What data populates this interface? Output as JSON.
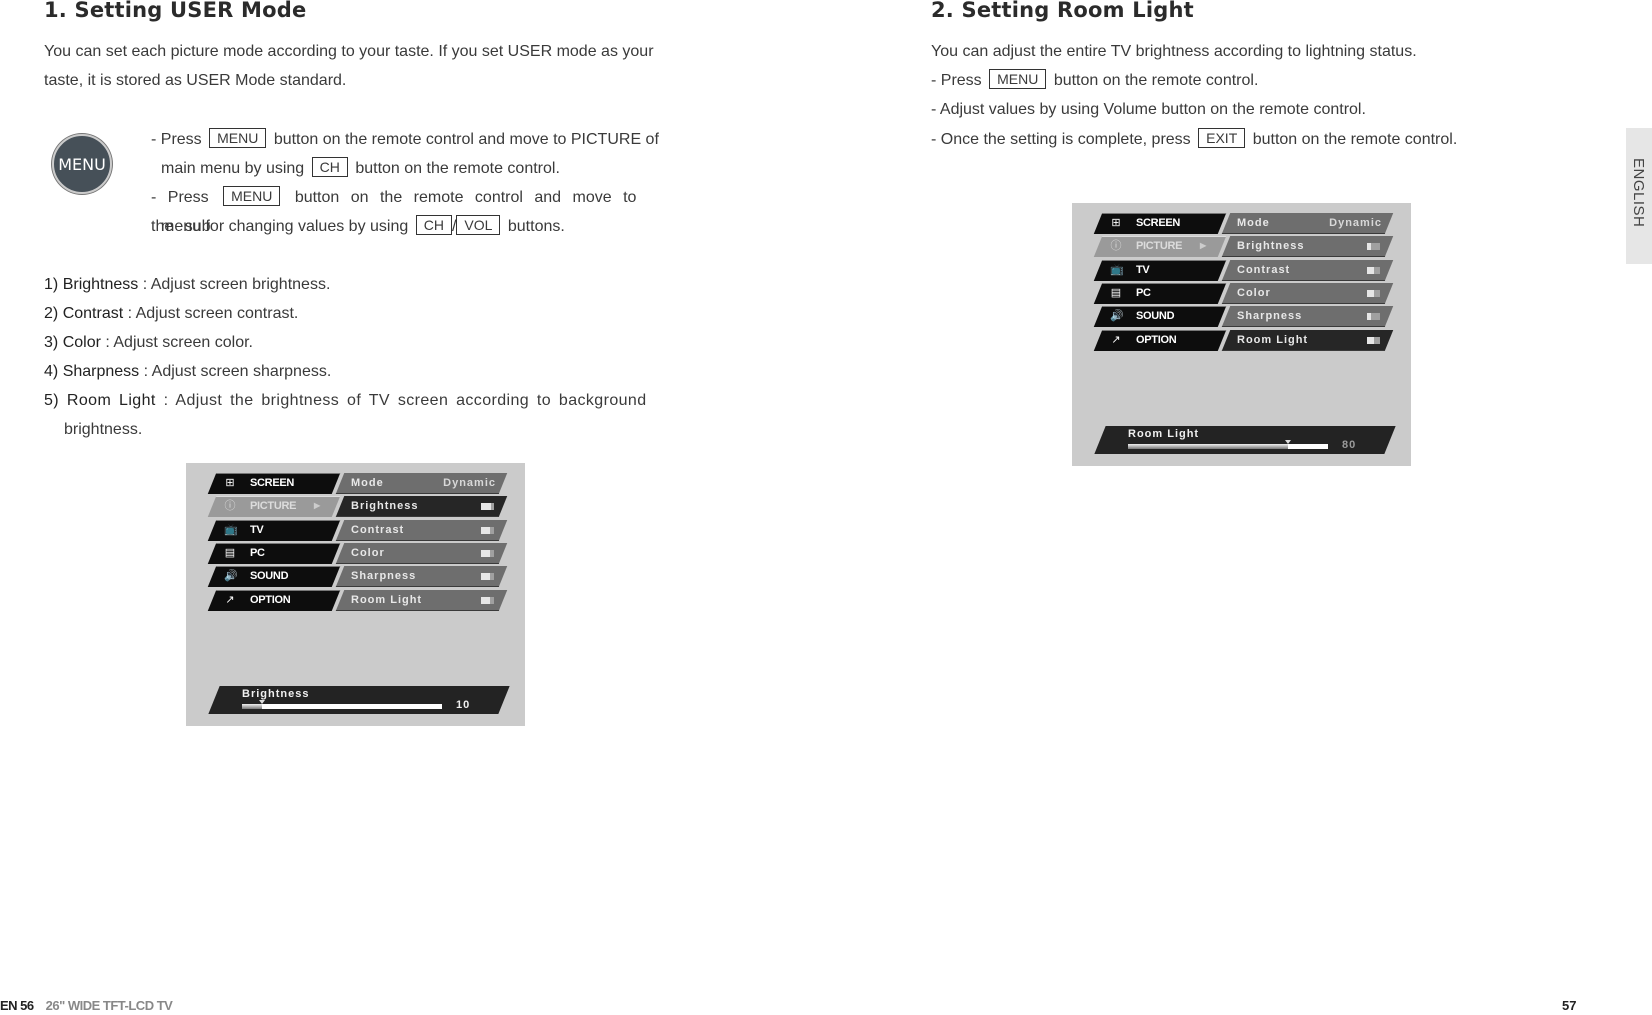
{
  "left_page": {
    "title": "1. Setting USER Mode",
    "intro_line1": "You can set each picture mode according to your taste. If you set USER mode as your",
    "intro_line2": "taste, it is stored as USER Mode standard.",
    "menu_icon_label": "MENU",
    "steps": {
      "s1_a": "- Press",
      "s1_key": "MENU",
      "s1_b": "button on the remote control and move to PICTURE of",
      "s1_c": "main menu by using",
      "s1_key2": "CH",
      "s1_d": "button on the remote control.",
      "s2_a": "- Press",
      "s2_key": "MENU",
      "s2_b": "button on the remote control and move to the sub",
      "s2_c": "menu for changing values by using",
      "s2_key2": "CH",
      "s2_sep": "/",
      "s2_key3": "VOL",
      "s2_d": "buttons."
    },
    "items": [
      {
        "num": "1)",
        "term": "Brightness",
        "desc": " : Adjust screen brightness."
      },
      {
        "num": "2)",
        "term": "Contrast",
        "desc": " : Adjust screen contrast."
      },
      {
        "num": "3)",
        "term": "Color",
        "desc": " : Adjust screen color."
      },
      {
        "num": "4)",
        "term": "Sharpness",
        "desc": " : Adjust screen sharpness."
      },
      {
        "num": "5)",
        "term": "Room Light",
        "desc": " : Adjust the brightness of TV screen according to background",
        "desc2": "brightness."
      }
    ],
    "screen": {
      "main_menu": [
        {
          "icon": "screen-icon",
          "glyph": "⊞",
          "label": "SCREEN"
        },
        {
          "icon": "picture-icon",
          "glyph": "ⓘ",
          "label": "PICTURE",
          "arrow": "▶"
        },
        {
          "icon": "tv-icon",
          "glyph": "📺",
          "label": "TV"
        },
        {
          "icon": "pc-icon",
          "glyph": "▤",
          "label": "PC"
        },
        {
          "icon": "sound-icon",
          "glyph": "🔊",
          "label": "SOUND"
        },
        {
          "icon": "option-icon",
          "glyph": "↗",
          "label": "OPTION"
        }
      ],
      "sub_menu": [
        {
          "label": "Mode",
          "value": "Dynamic"
        },
        {
          "label": "Brightness",
          "level": 0.75
        },
        {
          "label": "Contrast",
          "level": 0.7
        },
        {
          "label": "Color",
          "level": 0.7
        },
        {
          "label": "Sharpness",
          "level": 0.7
        },
        {
          "label": "Room Light",
          "level": 0.7
        }
      ],
      "selected_sub": "Brightness",
      "slider": {
        "label": "Brightness",
        "value": "10",
        "fraction": 0.1
      }
    }
  },
  "right_page": {
    "title": "2. Setting Room Light",
    "line1": "You can adjust the entire TV brightness according to lightning status.",
    "line2_a": "- Press",
    "line2_key": "MENU",
    "line2_b": "button on the remote control.",
    "line3": "- Adjust values by using Volume button on the remote control.",
    "line4_a": "- Once the setting is complete, press",
    "line4_key": "EXIT",
    "line4_b": "button on the remote control.",
    "screen": {
      "main_menu": [
        {
          "icon": "screen-icon",
          "glyph": "⊞",
          "label": "SCREEN"
        },
        {
          "icon": "picture-icon",
          "glyph": "ⓘ",
          "label": "PICTURE",
          "arrow": "▶"
        },
        {
          "icon": "tv-icon",
          "glyph": "📺",
          "label": "TV"
        },
        {
          "icon": "pc-icon",
          "glyph": "▤",
          "label": "PC"
        },
        {
          "icon": "sound-icon",
          "glyph": "🔊",
          "label": "SOUND"
        },
        {
          "icon": "option-icon",
          "glyph": "↗",
          "label": "OPTION"
        }
      ],
      "sub_menu": [
        {
          "label": "Mode",
          "value": "Dynamic"
        },
        {
          "label": "Brightness",
          "level": 0.3
        },
        {
          "label": "Contrast",
          "level": 0.5
        },
        {
          "label": "Color",
          "level": 0.5
        },
        {
          "label": "Sharpness",
          "level": 0.3
        },
        {
          "label": "Room Light",
          "level": 0.5
        }
      ],
      "selected_sub": "Room Light",
      "slider": {
        "label": "Room Light",
        "value": "80",
        "fraction": 0.8
      }
    },
    "side_tab": "ENGLISH"
  },
  "footer": {
    "left_page_num": "EN 56",
    "left_product": "26\" WIDE TFT-LCD TV",
    "right_page_num": "57"
  }
}
